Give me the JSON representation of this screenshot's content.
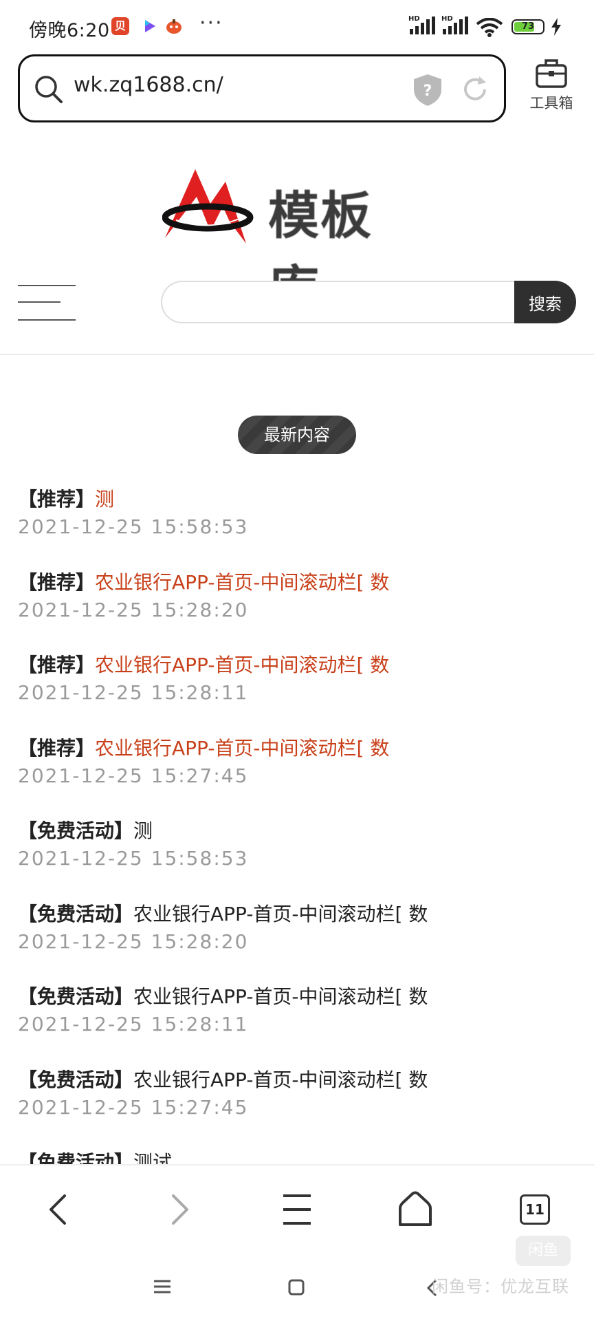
{
  "status_bar": {
    "time": "傍晚6:20",
    "battery_percent": "73",
    "signal_label": "HD",
    "colors": {
      "battery_fill": "#6ecf3c",
      "badge_red": "#e0452a"
    }
  },
  "browser": {
    "url": "wk.zq1688.cn/",
    "toolbox_label": "工具箱",
    "tab_count": "11"
  },
  "site": {
    "logo_text": "模板库",
    "search_placeholder": "",
    "search_button": "搜索",
    "section_title": "最新内容",
    "items": [
      {
        "tag": "【推荐】",
        "title": "测",
        "date": "2021-12-25 15:58:53",
        "highlight": true
      },
      {
        "tag": "【推荐】",
        "title": "农业银行APP-首页-中间滚动栏[ 数",
        "date": "2021-12-25 15:28:20",
        "highlight": true
      },
      {
        "tag": "【推荐】",
        "title": "农业银行APP-首页-中间滚动栏[ 数",
        "date": "2021-12-25 15:28:11",
        "highlight": true
      },
      {
        "tag": "【推荐】",
        "title": "农业银行APP-首页-中间滚动栏[ 数",
        "date": "2021-12-25 15:27:45",
        "highlight": true
      },
      {
        "tag": "【免费活动】",
        "title": "测",
        "date": "2021-12-25 15:58:53",
        "highlight": false
      },
      {
        "tag": "【免费活动】",
        "title": "农业银行APP-首页-中间滚动栏[ 数",
        "date": "2021-12-25 15:28:20",
        "highlight": false
      },
      {
        "tag": "【免费活动】",
        "title": "农业银行APP-首页-中间滚动栏[ 数",
        "date": "2021-12-25 15:28:11",
        "highlight": false
      },
      {
        "tag": "【免费活动】",
        "title": "农业银行APP-首页-中间滚动栏[ 数",
        "date": "2021-12-25 15:27:45",
        "highlight": false
      },
      {
        "tag": "【免费活动】",
        "title": "测试",
        "date": "",
        "highlight": false
      }
    ],
    "colors": {
      "highlight_title": "#c8401a",
      "date_gray": "#9a9a9a"
    }
  },
  "watermark": {
    "box": "闲鱼",
    "text": "闲鱼号：优龙互联"
  }
}
